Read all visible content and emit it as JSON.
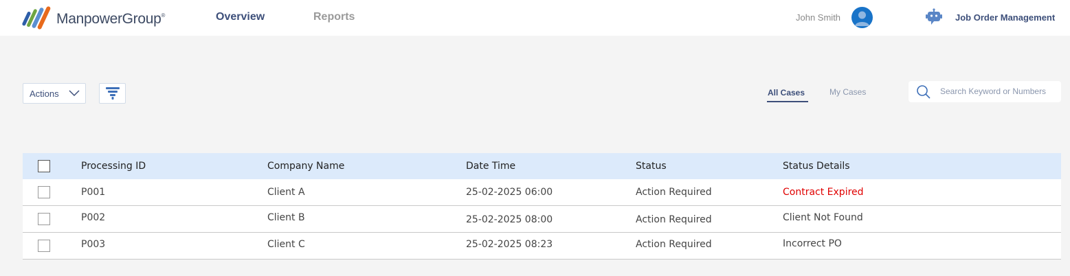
{
  "header": {
    "brand": "ManpowerGroup",
    "brand_mark": "®",
    "nav": {
      "overview": "Overview",
      "reports": "Reports"
    },
    "user_name": "John Smith",
    "app_title": "Job Order Management"
  },
  "toolbar": {
    "actions_label": "Actions",
    "tabs": {
      "all": "All Cases",
      "mine": "My Cases"
    },
    "search_placeholder": "Search Keyword or Numbers"
  },
  "table": {
    "columns": [
      "Processing ID",
      "Company Name",
      "Date Time",
      "Status",
      "Status Details"
    ],
    "rows": [
      {
        "id": "P001",
        "company": "Client A",
        "datetime": "25-02-2025 06:00",
        "status": "Action Required",
        "details": "Contract Expired"
      },
      {
        "id": "P002",
        "company": "Client B",
        "datetime": "25-02-2025 08:00",
        "status": "Action Required",
        "details": "Client Not Found"
      },
      {
        "id": "P003",
        "company": "Client C",
        "datetime": "25-02-2025 08:23",
        "status": "Action Required",
        "details": "Incorrect PO"
      }
    ]
  },
  "colors": {
    "primary": "#3d4f7a",
    "header_row": "#dceafb",
    "alert": "#e00000",
    "avatar": "#1873c8"
  },
  "icons": [
    "logo-mark-icon",
    "avatar-icon",
    "chatbot-icon",
    "chevron-down-icon",
    "filter-icon",
    "search-icon"
  ]
}
